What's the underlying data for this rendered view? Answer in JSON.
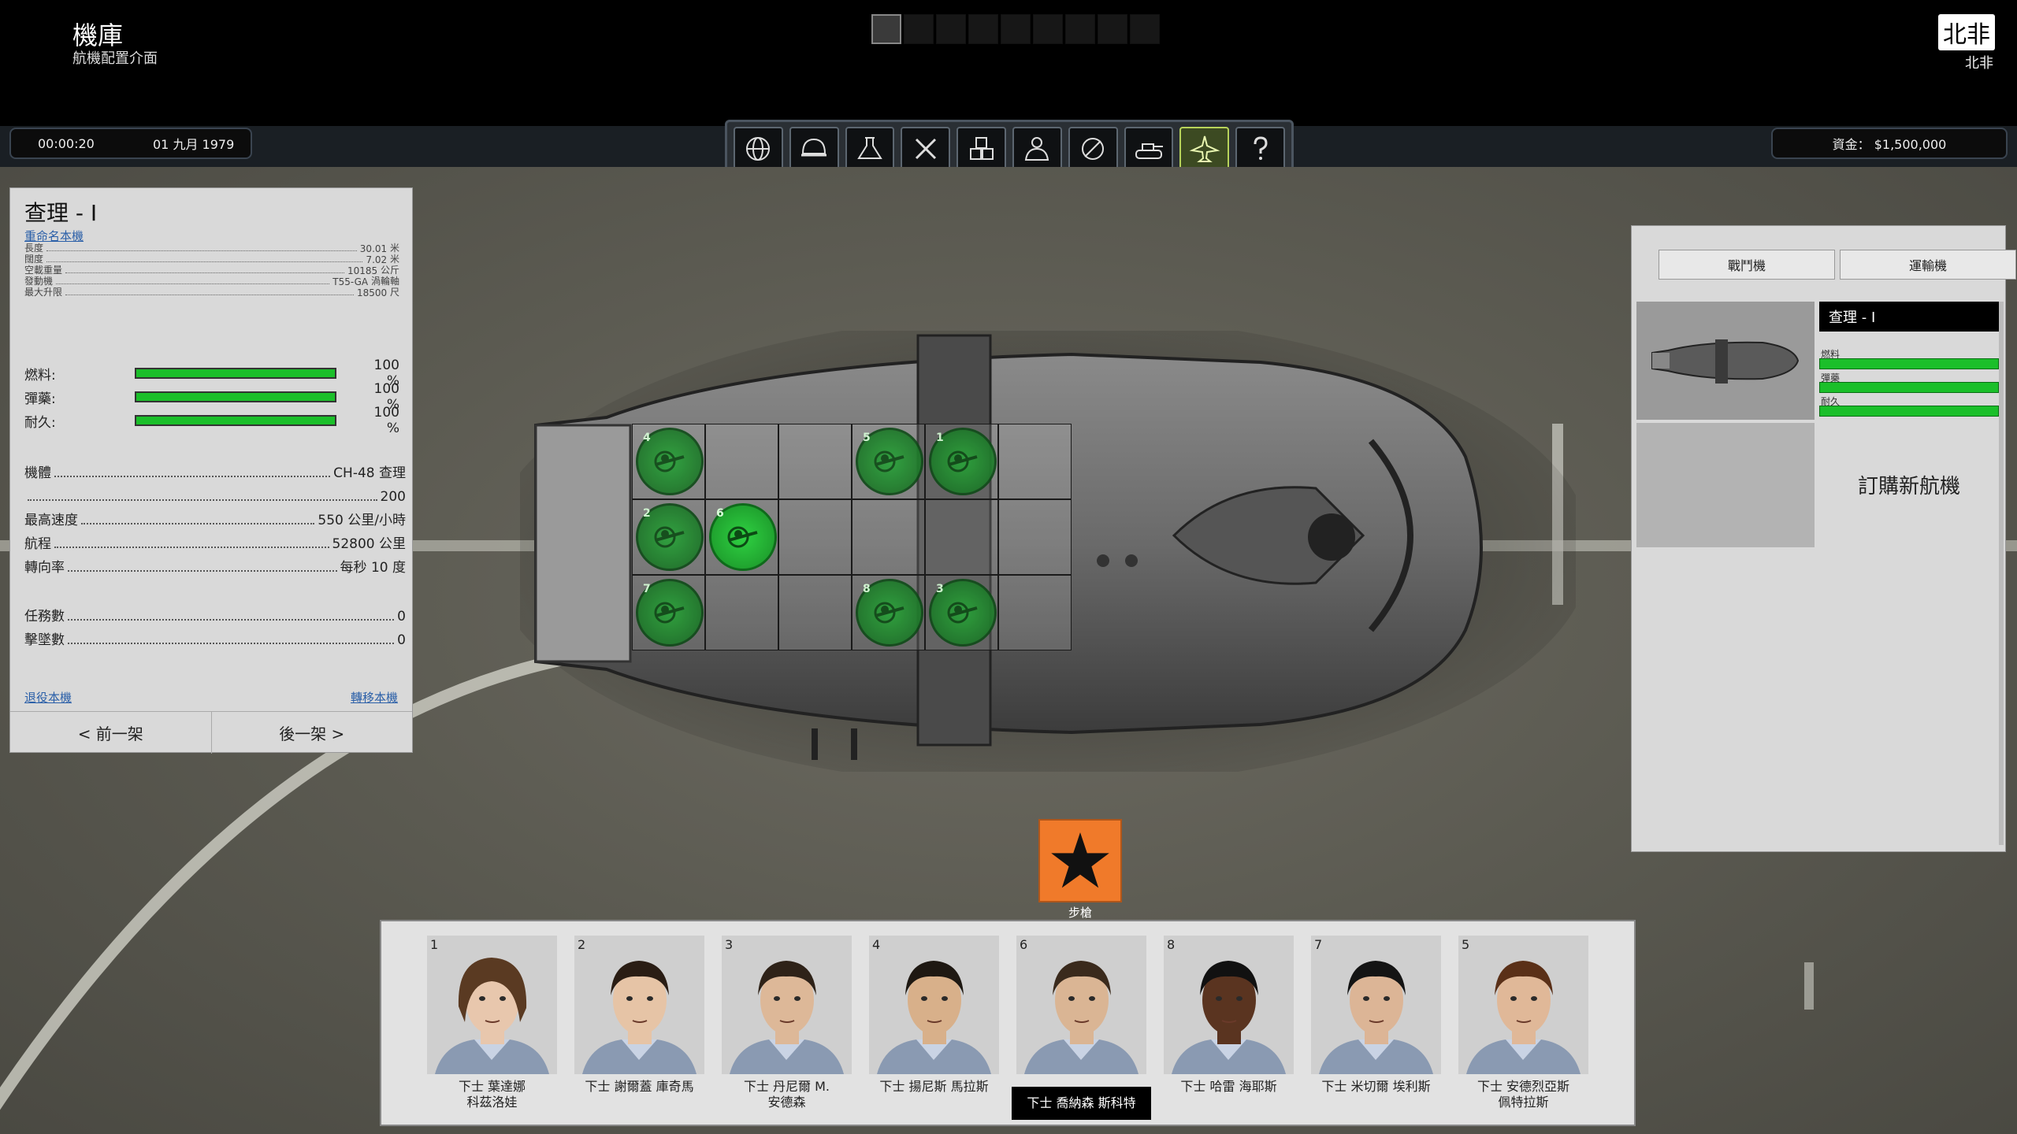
{
  "header": {
    "title": "機庫",
    "subtitle": "航機配置介面",
    "region_badge": "北非",
    "region_sub": "北非",
    "speed_steps": 9,
    "speed_active": 0
  },
  "status": {
    "time": "00:00:20",
    "date": "01 九月 1979",
    "funds": "資金： $1,500,000"
  },
  "toolbar": {
    "buttons": [
      "globe-icon",
      "helmet-icon",
      "flask-icon",
      "tools-icon",
      "crates-icon",
      "personnel-icon",
      "intel-icon",
      "tank-icon",
      "aircraft-icon",
      "help-icon"
    ],
    "active": "aircraft-icon",
    "accent_active": "#b7d35a"
  },
  "left_panel": {
    "name": "查理 - I",
    "rename": "重命名本機",
    "specs": [
      {
        "label": "長度",
        "value": "30.01",
        "unit": "米"
      },
      {
        "label": "闊度",
        "value": "7.02",
        "unit": "米"
      },
      {
        "label": "空載重量",
        "value": "10185",
        "unit": "公斤"
      },
      {
        "label": "發動機",
        "value": "T55-GA",
        "unit": "渦輪軸"
      },
      {
        "label": "最大升限",
        "value": "18500",
        "unit": "尺"
      }
    ],
    "bars": [
      {
        "label": "燃料:",
        "pct": "100 %",
        "level": 1.0
      },
      {
        "label": "彈藥:",
        "pct": "100 %",
        "level": 1.0
      },
      {
        "label": "耐久:",
        "pct": "100 %",
        "level": 1.0
      }
    ],
    "info": [
      {
        "label": "機體",
        "value": "CH-48 查理"
      },
      {
        "label": "",
        "value": "200"
      },
      {
        "label": "最高速度",
        "value": "550 公里/小時"
      },
      {
        "label": "航程",
        "value": "52800 公里"
      },
      {
        "label": "轉向率",
        "value": "每秒 10 度"
      },
      {
        "label": "任務數",
        "value": "0"
      },
      {
        "label": "擊墜數",
        "value": "0"
      }
    ],
    "dismiss": "退役本機",
    "transfer": "轉移本機",
    "prev": "<  前一架",
    "next": "後一架  >"
  },
  "right_panel": {
    "tab_fighter": "戰鬥機",
    "tab_transport": "運輸機",
    "selected_name": "查理 - I",
    "bar_labels": [
      "燃料",
      "彈藥",
      "耐久"
    ],
    "order": "訂購新航機"
  },
  "cargo": {
    "seats": [
      {
        "slot": "4",
        "row": 0,
        "col": 0
      },
      {
        "slot": "5",
        "row": 0,
        "col": 3
      },
      {
        "slot": "1",
        "row": 0,
        "col": 4
      },
      {
        "slot": "2",
        "row": 1,
        "col": 0
      },
      {
        "slot": "6",
        "row": 1,
        "col": 1,
        "selected": true
      },
      {
        "slot": "7",
        "row": 2,
        "col": 0
      },
      {
        "slot": "8",
        "row": 2,
        "col": 3
      },
      {
        "slot": "3",
        "row": 2,
        "col": 4
      }
    ],
    "seat_color": "#1bbf2a"
  },
  "class_badge": {
    "label": "步槍",
    "color": "#f07a2a"
  },
  "soldiers": [
    {
      "idx": "1",
      "name": "下士 葉達娜\n科茲洛娃",
      "skin": "#e8c7ad",
      "hair": "#5a3a22",
      "female": true
    },
    {
      "idx": "2",
      "name": "下士 謝爾蓋 庫奇馬",
      "skin": "#e6c4a6",
      "hair": "#2a1d14"
    },
    {
      "idx": "3",
      "name": "下士 丹尼爾 M.\n安德森",
      "skin": "#ddb898",
      "hair": "#2e2218"
    },
    {
      "idx": "4",
      "name": "下士 揚尼斯 馬拉斯",
      "skin": "#d8b08a",
      "hair": "#1e1812"
    },
    {
      "idx": "6",
      "name": "下士 喬納森 斯科特",
      "skin": "#dab594",
      "hair": "#3a2a1c",
      "active": true
    },
    {
      "idx": "8",
      "name": "下士 哈雷 海耶斯",
      "skin": "#5a3420",
      "hair": "#111"
    },
    {
      "idx": "7",
      "name": "下士 米切爾 埃利斯",
      "skin": "#dcb596",
      "hair": "#141414"
    },
    {
      "idx": "5",
      "name": "下士 安德烈亞斯\n佩特拉斯",
      "skin": "#e0b898",
      "hair": "#5a3018"
    }
  ]
}
